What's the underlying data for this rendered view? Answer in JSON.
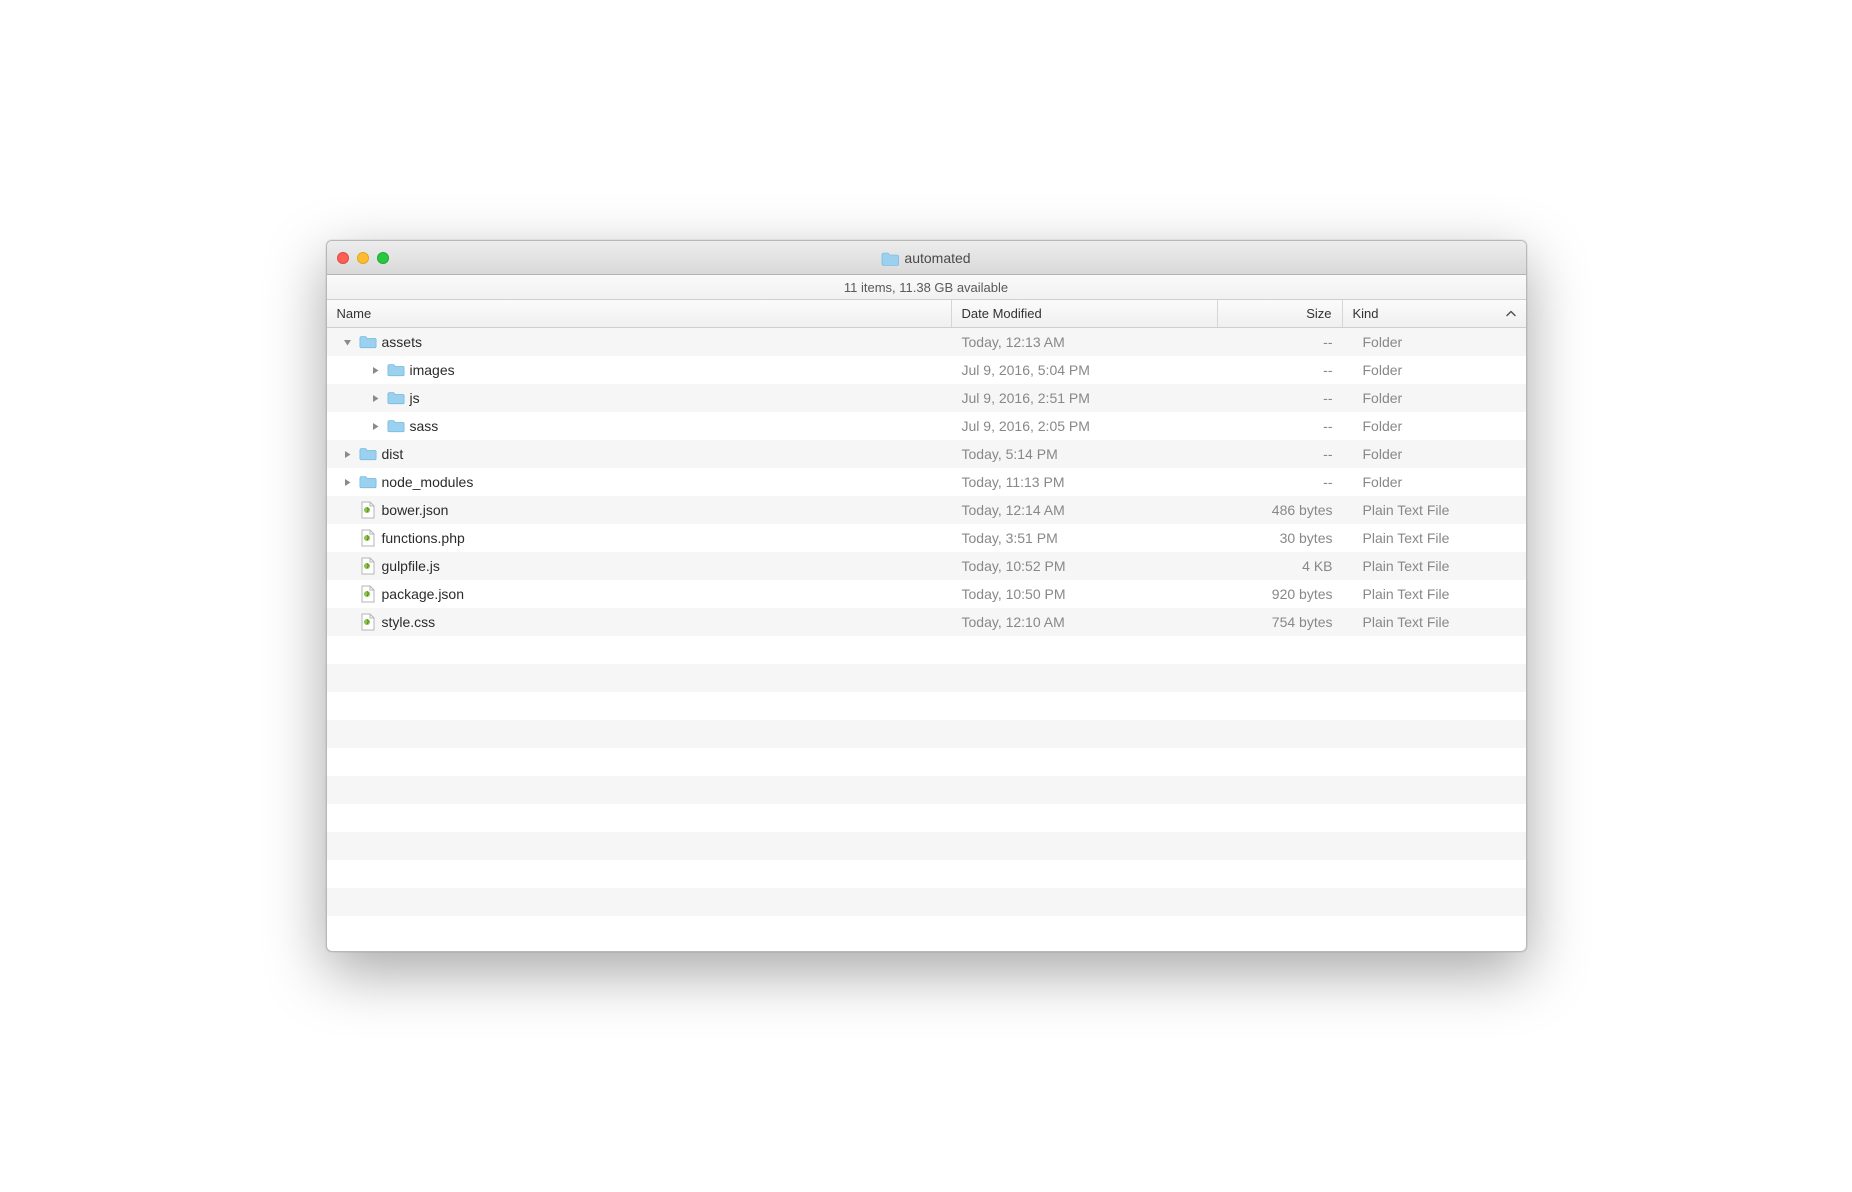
{
  "window": {
    "title": "automated"
  },
  "status": "11 items, 11.38 GB available",
  "columns": {
    "name": "Name",
    "date": "Date Modified",
    "size": "Size",
    "kind": "Kind"
  },
  "rows": [
    {
      "name": "assets",
      "date": "Today, 12:13 AM",
      "size": "--",
      "kind": "Folder",
      "type": "folder",
      "indent": 0,
      "disclosure": "down"
    },
    {
      "name": "images",
      "date": "Jul 9, 2016, 5:04 PM",
      "size": "--",
      "kind": "Folder",
      "type": "folder",
      "indent": 1,
      "disclosure": "right"
    },
    {
      "name": "js",
      "date": "Jul 9, 2016, 2:51 PM",
      "size": "--",
      "kind": "Folder",
      "type": "folder",
      "indent": 1,
      "disclosure": "right"
    },
    {
      "name": "sass",
      "date": "Jul 9, 2016, 2:05 PM",
      "size": "--",
      "kind": "Folder",
      "type": "folder",
      "indent": 1,
      "disclosure": "right"
    },
    {
      "name": "dist",
      "date": "Today, 5:14 PM",
      "size": "--",
      "kind": "Folder",
      "type": "folder",
      "indent": 0,
      "disclosure": "right"
    },
    {
      "name": "node_modules",
      "date": "Today, 11:13 PM",
      "size": "--",
      "kind": "Folder",
      "type": "folder",
      "indent": 0,
      "disclosure": "right"
    },
    {
      "name": "bower.json",
      "date": "Today, 12:14 AM",
      "size": "486 bytes",
      "kind": "Plain Text File",
      "type": "file",
      "indent": 0,
      "disclosure": "none"
    },
    {
      "name": "functions.php",
      "date": "Today, 3:51 PM",
      "size": "30 bytes",
      "kind": "Plain Text File",
      "type": "file",
      "indent": 0,
      "disclosure": "none"
    },
    {
      "name": "gulpfile.js",
      "date": "Today, 10:52 PM",
      "size": "4 KB",
      "kind": "Plain Text File",
      "type": "file",
      "indent": 0,
      "disclosure": "none"
    },
    {
      "name": "package.json",
      "date": "Today, 10:50 PM",
      "size": "920 bytes",
      "kind": "Plain Text File",
      "type": "file",
      "indent": 0,
      "disclosure": "none"
    },
    {
      "name": "style.css",
      "date": "Today, 12:10 AM",
      "size": "754 bytes",
      "kind": "Plain Text File",
      "type": "file",
      "indent": 0,
      "disclosure": "none"
    }
  ]
}
